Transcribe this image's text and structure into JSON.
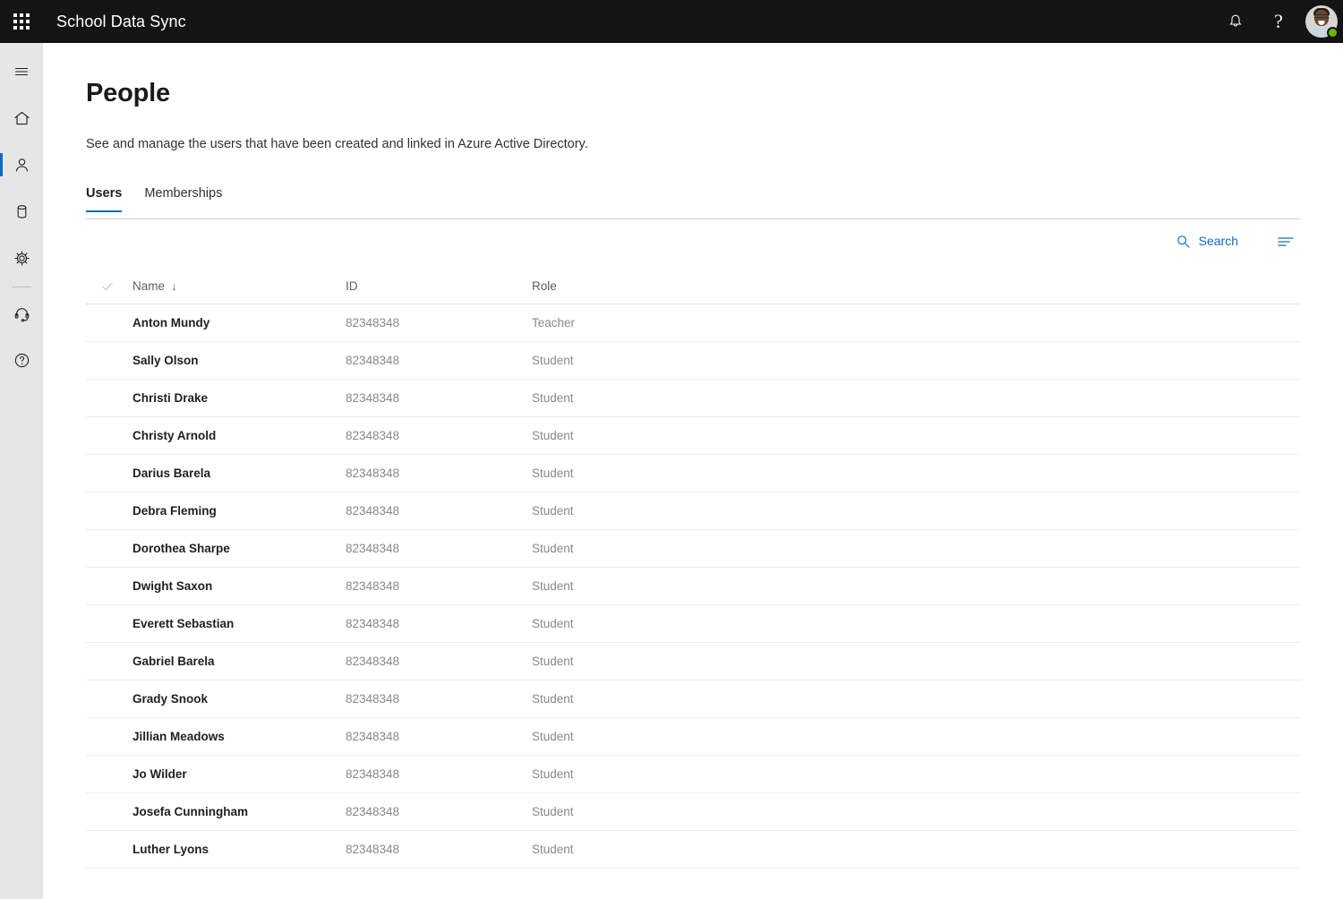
{
  "topbar": {
    "app_launcher_icon": "waffle-grid-icon",
    "title": "School Data Sync",
    "notifications_icon": "bell-icon",
    "help_icon": "question-mark-icon",
    "help_glyph": "?",
    "avatar_name": "user-avatar",
    "presence": "available",
    "presence_color": "#6bb700",
    "background_color": "#141414"
  },
  "rail": {
    "background_color": "#e6e6e6",
    "accent_color": "#0f6cbd",
    "items": [
      {
        "icon": "hamburger-menu-icon",
        "name": "menu",
        "selected": false
      },
      {
        "icon": "home-icon",
        "name": "home",
        "selected": false
      },
      {
        "icon": "person-icon",
        "name": "people",
        "selected": true
      },
      {
        "icon": "database-icon",
        "name": "data",
        "selected": false
      },
      {
        "icon": "gear-icon",
        "name": "settings",
        "selected": false
      },
      {
        "icon": "headset-icon",
        "name": "support",
        "selected": false
      },
      {
        "icon": "help-circle-icon",
        "name": "help",
        "selected": false
      }
    ]
  },
  "page": {
    "title": "People",
    "subtitle": "See and manage the users that have been created and linked in Azure Active Directory."
  },
  "tabs": [
    {
      "label": "Users",
      "active": true
    },
    {
      "label": "Memberships",
      "active": false
    }
  ],
  "commandbar": {
    "search_label": "Search",
    "search_icon": "search-icon",
    "filter_icon": "filter-icon",
    "accent_color": "#0f6cbd"
  },
  "table": {
    "select_all_icon": "checkmark-icon",
    "columns": [
      {
        "label": "Name",
        "sorted": true,
        "sort_direction": "descending",
        "sort_glyph": "↓"
      },
      {
        "label": "ID",
        "sorted": false
      },
      {
        "label": "Role",
        "sorted": false
      }
    ],
    "rows": [
      {
        "name": "Anton Mundy",
        "id": "82348348",
        "role": "Teacher"
      },
      {
        "name": "Sally Olson",
        "id": "82348348",
        "role": "Student"
      },
      {
        "name": "Christi Drake",
        "id": "82348348",
        "role": "Student"
      },
      {
        "name": "Christy Arnold",
        "id": "82348348",
        "role": "Student"
      },
      {
        "name": "Darius Barela",
        "id": "82348348",
        "role": "Student"
      },
      {
        "name": "Debra Fleming",
        "id": "82348348",
        "role": "Student"
      },
      {
        "name": "Dorothea Sharpe",
        "id": "82348348",
        "role": "Student"
      },
      {
        "name": "Dwight Saxon",
        "id": "82348348",
        "role": "Student"
      },
      {
        "name": "Everett Sebastian",
        "id": "82348348",
        "role": "Student"
      },
      {
        "name": "Gabriel Barela",
        "id": "82348348",
        "role": "Student"
      },
      {
        "name": "Grady Snook",
        "id": "82348348",
        "role": "Student"
      },
      {
        "name": "Jillian Meadows",
        "id": "82348348",
        "role": "Student"
      },
      {
        "name": "Jo Wilder",
        "id": "82348348",
        "role": "Student"
      },
      {
        "name": "Josefa Cunningham",
        "id": "82348348",
        "role": "Student"
      },
      {
        "name": "Luther Lyons",
        "id": "82348348",
        "role": "Student"
      }
    ]
  }
}
